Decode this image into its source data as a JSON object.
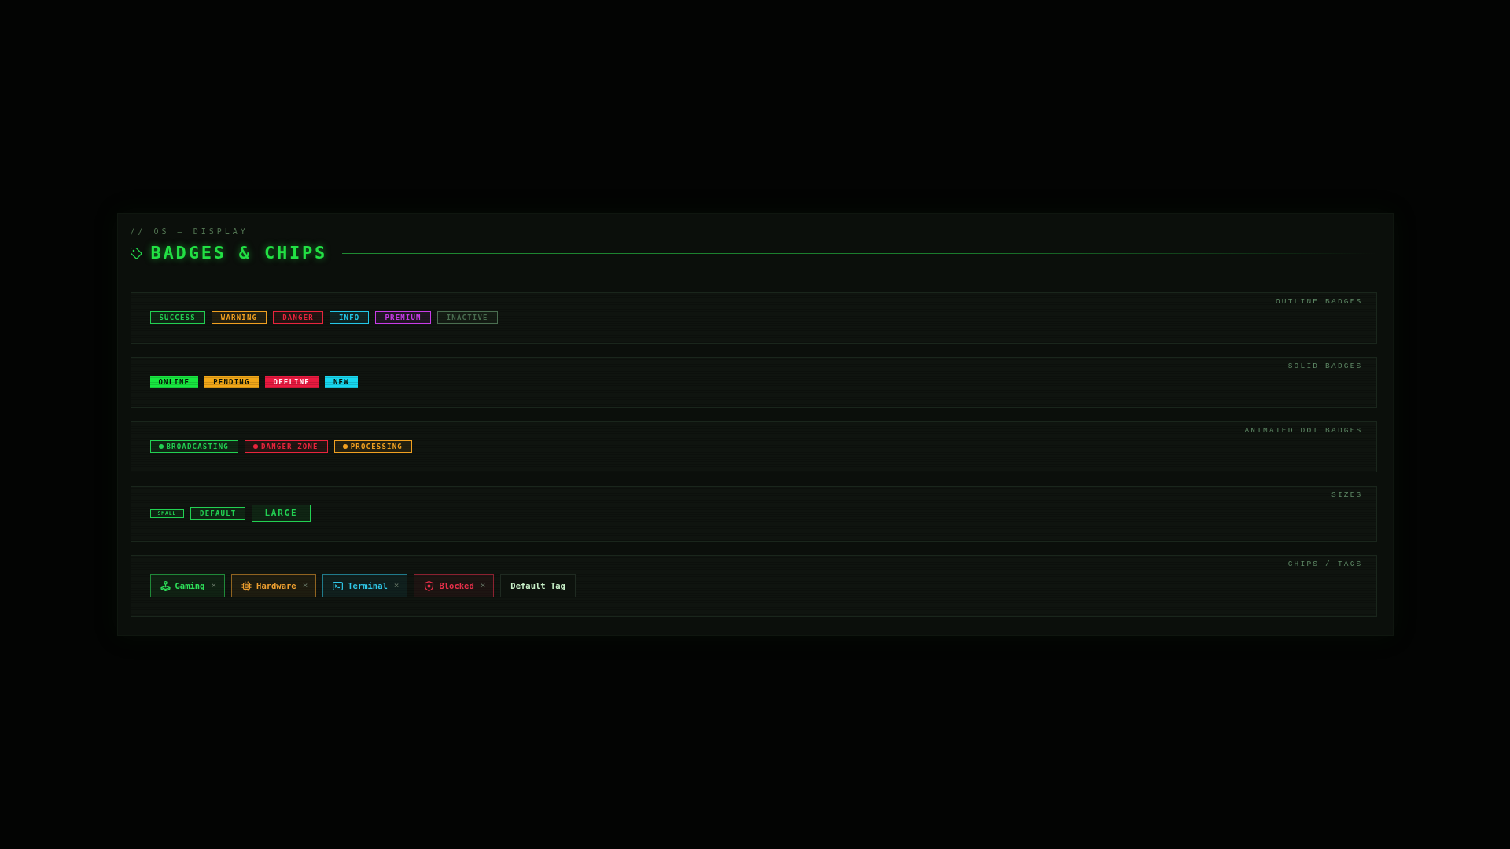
{
  "header": {
    "breadcrumb": "// OS — DISPLAY",
    "title": "BADGES & CHIPS"
  },
  "sections": [
    {
      "label": "OUTLINE BADGES",
      "kind": "outline",
      "badges": [
        {
          "text": "SUCCESS",
          "color": "#22d052"
        },
        {
          "text": "WARNING",
          "color": "#f0a020"
        },
        {
          "text": "DANGER",
          "color": "#e8243c"
        },
        {
          "text": "INFO",
          "color": "#22c8e8"
        },
        {
          "text": "PREMIUM",
          "color": "#c83ce8"
        },
        {
          "text": "INACTIVE",
          "color": "#4a6e50"
        }
      ]
    },
    {
      "label": "SOLID BADGES",
      "kind": "solid",
      "badges": [
        {
          "text": "ONLINE",
          "color": "#18e840"
        },
        {
          "text": "PENDING",
          "color": "#f2a818"
        },
        {
          "text": "OFFLINE",
          "color": "#ea1a40"
        },
        {
          "text": "NEW",
          "color": "#18d8f0"
        }
      ]
    },
    {
      "label": "ANIMATED DOT BADGES",
      "kind": "dot",
      "badges": [
        {
          "text": "BROADCASTING",
          "color": "#22d052"
        },
        {
          "text": "DANGER ZONE",
          "color": "#e8243c"
        },
        {
          "text": "PROCESSING",
          "color": "#f0a020"
        }
      ]
    },
    {
      "label": "SIZES",
      "kind": "sizes",
      "badges": [
        {
          "text": "SMALL",
          "kind": "small"
        },
        {
          "text": "DEFAULT",
          "kind": "default"
        },
        {
          "text": "LARGE",
          "kind": "large"
        }
      ]
    },
    {
      "label": "CHIPS / TAGS",
      "kind": "chips",
      "chips": [
        {
          "text": "Gaming",
          "kind": "icon",
          "color": "#2ee05a",
          "close": "×"
        },
        {
          "text": "Hardware",
          "kind": "icon",
          "color": "#f0a030",
          "close": "×"
        },
        {
          "text": "Terminal",
          "kind": "icon",
          "color": "#30c8e8",
          "close": "×"
        },
        {
          "text": "Blocked",
          "kind": "icon",
          "color": "#e8304a",
          "close": "×"
        },
        {
          "text": "Default Tag",
          "kind": "plain",
          "color": "#c8f0c8"
        }
      ]
    }
  ]
}
